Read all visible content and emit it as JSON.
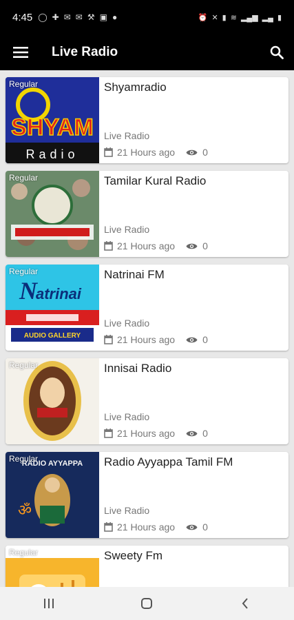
{
  "status": {
    "time": "4:45"
  },
  "appbar": {
    "title": "Live Radio"
  },
  "stations": [
    {
      "name": "Shyamradio",
      "badge": "Regular",
      "category": "Live Radio",
      "ago": "21 Hours ago",
      "views": "0",
      "logo_text": "SHYAM",
      "logo_sub": "Radio"
    },
    {
      "name": "Tamilar Kural Radio",
      "badge": "Regular",
      "category": "Live Radio",
      "ago": "21 Hours ago",
      "views": "0"
    },
    {
      "name": "Natrinai FM",
      "badge": "Regular",
      "category": "Live Radio",
      "ago": "21 Hours ago",
      "views": "0",
      "logo_text": "atrinai",
      "logo_sub": "AUDIO GALLERY"
    },
    {
      "name": "Innisai Radio",
      "badge": "Regular",
      "category": "Live Radio",
      "ago": "21 Hours ago",
      "views": "0"
    },
    {
      "name": "Radio Ayyappa Tamil FM",
      "badge": "Regular",
      "category": "Live Radio",
      "ago": "21 Hours ago",
      "views": "0",
      "logo_text": "RADIO AYYAPPA"
    },
    {
      "name": "Sweety Fm",
      "badge": "Regular",
      "category": "",
      "ago": "",
      "views": ""
    }
  ],
  "colors": {
    "appbar": "#000000",
    "card": "#ffffff",
    "meta": "#777777",
    "background": "#e8e8e8"
  }
}
